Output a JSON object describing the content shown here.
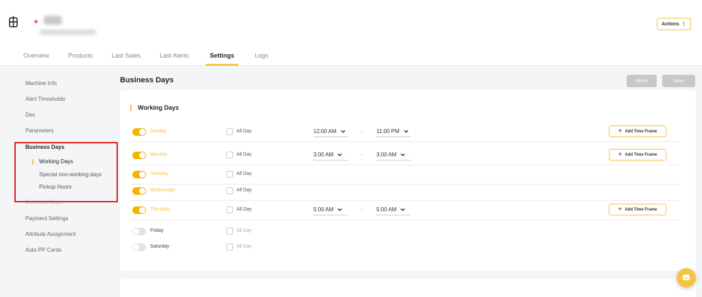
{
  "header": {
    "actions_label": "Actions",
    "actions_glyph": "⋮",
    "tabs": [
      {
        "label": "Overview",
        "active": false
      },
      {
        "label": "Products",
        "active": false
      },
      {
        "label": "Last Sales",
        "active": false
      },
      {
        "label": "Last Alerts",
        "active": false
      },
      {
        "label": "Settings",
        "active": true
      },
      {
        "label": "Logs",
        "active": false
      }
    ]
  },
  "sidebar": {
    "items": [
      {
        "label": "Machine Info"
      },
      {
        "label": "Alert Thresholds"
      },
      {
        "label": "Dex"
      },
      {
        "label": "Parameters"
      },
      {
        "label": "Business Days"
      },
      {
        "label": "Payment Settings"
      },
      {
        "label": "Attribute Assignment"
      },
      {
        "label": "Auto PP Cards"
      }
    ],
    "sub_items": [
      {
        "label": "Working Days",
        "active": true
      },
      {
        "label": "Special non-working days",
        "active": false
      },
      {
        "label": "Pickup Hours",
        "active": false
      }
    ]
  },
  "main": {
    "section_title": "Business Days",
    "reset_label": "Reset",
    "save_label": "Save",
    "working_days_title": "Working Days",
    "all_day_label": "All Day",
    "dash": "-",
    "add_time_frame_label": "Add Time Frame",
    "days": [
      {
        "name": "Sunday",
        "enabled": true,
        "from": "12:00 AM",
        "to": "11:00 PM",
        "add_time_frame": true
      },
      {
        "name": "Monday",
        "enabled": true,
        "from": "3:00 AM",
        "to": "3:00 AM",
        "add_time_frame": true
      },
      {
        "name": "Tuesday",
        "enabled": true,
        "from": null,
        "to": null,
        "add_time_frame": false
      },
      {
        "name": "Wednesday",
        "enabled": true,
        "from": null,
        "to": null,
        "add_time_frame": false
      },
      {
        "name": "Thursday",
        "enabled": true,
        "from": "5:00 AM",
        "to": "5:00 AM",
        "add_time_frame": true
      },
      {
        "name": "Friday",
        "enabled": false,
        "from": null,
        "to": null,
        "add_time_frame": false
      },
      {
        "name": "Saturday",
        "enabled": false,
        "from": null,
        "to": null,
        "add_time_frame": false
      }
    ]
  },
  "colors": {
    "accent": "#f6c343",
    "highlight": "#d9211a"
  },
  "icons": [
    "machine-logo-icon",
    "chevron-down-icon",
    "plus-icon",
    "chat-icon"
  ]
}
